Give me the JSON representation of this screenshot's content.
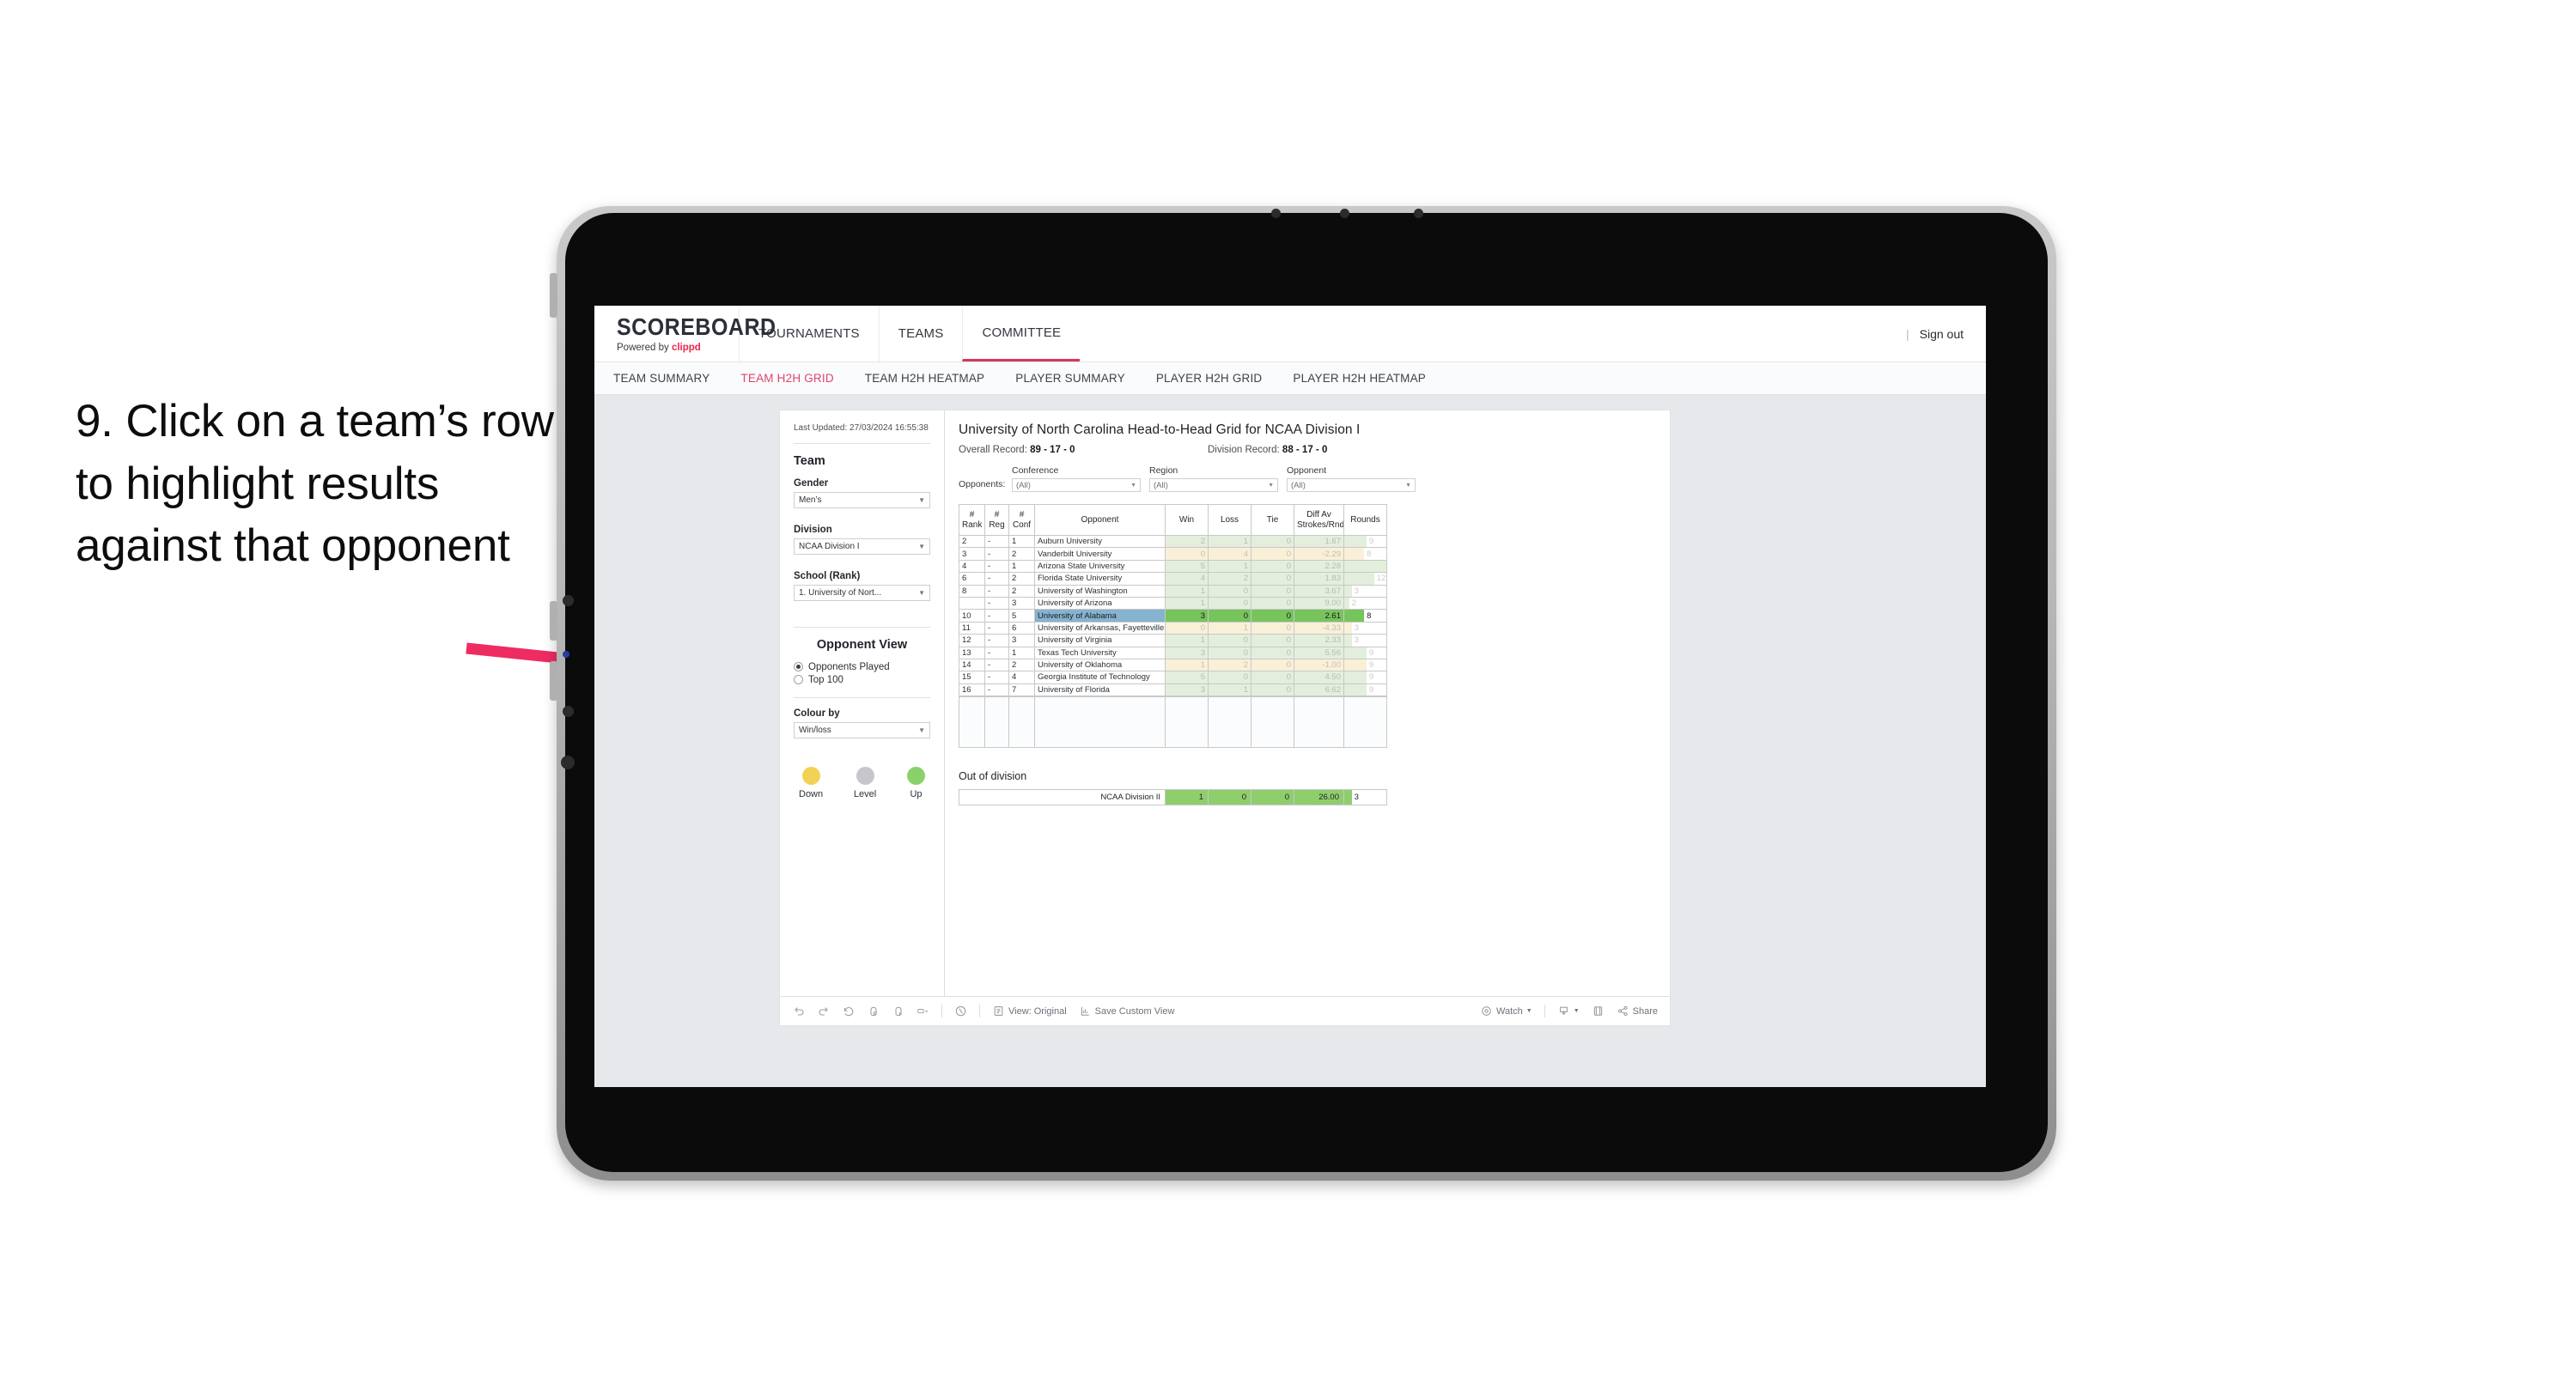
{
  "annotation": {
    "text": "9. Click on a team’s row to highlight results against that opponent",
    "arrow_color": "#ee2c62"
  },
  "topbar": {
    "brand_title": "SCOREBOARD",
    "brand_sub_prefix": "Powered by ",
    "brand_sub_name": "clippd",
    "nav": [
      {
        "label": "TOURNAMENTS",
        "active": false
      },
      {
        "label": "TEAMS",
        "active": false
      },
      {
        "label": "COMMITTEE",
        "active": true
      }
    ],
    "divider": "|",
    "sign_out": "Sign out"
  },
  "subnav": {
    "items": [
      {
        "label": "TEAM SUMMARY",
        "active": false
      },
      {
        "label": "TEAM H2H GRID",
        "active": true
      },
      {
        "label": "TEAM H2H HEATMAP",
        "active": false
      },
      {
        "label": "PLAYER SUMMARY",
        "active": false
      },
      {
        "label": "PLAYER H2H GRID",
        "active": false
      },
      {
        "label": "PLAYER H2H HEATMAP",
        "active": false
      }
    ],
    "accent": "#e0456b"
  },
  "panel": {
    "last_updated": "Last Updated: 27/03/2024 16:55:38",
    "team_heading": "Team",
    "gender_label": "Gender",
    "gender_value": "Men’s",
    "division_label": "Division",
    "division_value": "NCAA Division I",
    "school_label": "School (Rank)",
    "school_value": "1. University of Nort...",
    "opponent_view_heading": "Opponent View",
    "opponent_view_options": [
      {
        "label": "Opponents Played",
        "selected": true
      },
      {
        "label": "Top 100",
        "selected": false
      }
    ],
    "colour_by_label": "Colour by",
    "colour_by_value": "Win/loss",
    "legend": [
      {
        "label": "Down",
        "color": "#f2d255"
      },
      {
        "label": "Level",
        "color": "#c6c7ca"
      },
      {
        "label": "Up",
        "color": "#8ad16a"
      }
    ]
  },
  "main": {
    "title": "University of North Carolina Head-to-Head Grid for NCAA Division I",
    "overall_record_label": "Overall Record: ",
    "overall_record_value": "89 - 17 - 0",
    "division_record_label": "Division Record: ",
    "division_record_value": "88 - 17 - 0",
    "opponents_label": "Opponents:",
    "filters": [
      {
        "label": "Conference",
        "value": "(All)"
      },
      {
        "label": "Region",
        "value": "(All)"
      },
      {
        "label": "Opponent",
        "value": "(All)"
      }
    ],
    "out_of_division_title": "Out of division"
  },
  "chart_data": {
    "type": "table",
    "title": "University of North Carolina Head-to-Head Grid for NCAA Division I",
    "columns": [
      "# Rank",
      "# Reg",
      "# Conf",
      "Opponent",
      "Win",
      "Loss",
      "Tie",
      "Diff Av Strokes/Rnd",
      "Rounds"
    ],
    "rounds_max": 17,
    "rows": [
      {
        "rank": "2",
        "reg": "-",
        "conf": "1",
        "opponent": "Auburn University",
        "win": "2",
        "loss": "1",
        "tie": "0",
        "diff": "1.67",
        "rounds": "9",
        "tone": "up",
        "selected": false
      },
      {
        "rank": "3",
        "reg": "-",
        "conf": "2",
        "opponent": "Vanderbilt University",
        "win": "0",
        "loss": "4",
        "tie": "0",
        "diff": "-2.29",
        "rounds": "8",
        "tone": "down",
        "selected": false
      },
      {
        "rank": "4",
        "reg": "-",
        "conf": "1",
        "opponent": "Arizona State University",
        "win": "5",
        "loss": "1",
        "tie": "0",
        "diff": "2.28",
        "rounds": "17",
        "tone": "up",
        "selected": false
      },
      {
        "rank": "6",
        "reg": "-",
        "conf": "2",
        "opponent": "Florida State University",
        "win": "4",
        "loss": "2",
        "tie": "0",
        "diff": "1.83",
        "rounds": "12",
        "tone": "up",
        "selected": false
      },
      {
        "rank": "8",
        "reg": "-",
        "conf": "2",
        "opponent": "University of Washington",
        "win": "1",
        "loss": "0",
        "tie": "0",
        "diff": "3.67",
        "rounds": "3",
        "tone": "up",
        "selected": false
      },
      {
        "rank": "",
        "reg": "-",
        "conf": "3",
        "opponent": "University of Arizona",
        "win": "1",
        "loss": "0",
        "tie": "0",
        "diff": "9.00",
        "rounds": "2",
        "tone": "up",
        "selected": false
      },
      {
        "rank": "10",
        "reg": "-",
        "conf": "5",
        "opponent": "University of Alabama",
        "win": "3",
        "loss": "0",
        "tie": "0",
        "diff": "2.61",
        "rounds": "8",
        "tone": "up",
        "selected": true
      },
      {
        "rank": "11",
        "reg": "-",
        "conf": "6",
        "opponent": "University of Arkansas, Fayetteville",
        "win": "0",
        "loss": "1",
        "tie": "0",
        "diff": "-4.33",
        "rounds": "3",
        "tone": "down",
        "selected": false
      },
      {
        "rank": "12",
        "reg": "-",
        "conf": "3",
        "opponent": "University of Virginia",
        "win": "1",
        "loss": "0",
        "tie": "0",
        "diff": "2.33",
        "rounds": "3",
        "tone": "up",
        "selected": false
      },
      {
        "rank": "13",
        "reg": "-",
        "conf": "1",
        "opponent": "Texas Tech University",
        "win": "3",
        "loss": "0",
        "tie": "0",
        "diff": "5.56",
        "rounds": "9",
        "tone": "up",
        "selected": false
      },
      {
        "rank": "14",
        "reg": "-",
        "conf": "2",
        "opponent": "University of Oklahoma",
        "win": "1",
        "loss": "2",
        "tie": "0",
        "diff": "-1.00",
        "rounds": "9",
        "tone": "down",
        "selected": false
      },
      {
        "rank": "15",
        "reg": "-",
        "conf": "4",
        "opponent": "Georgia Institute of Technology",
        "win": "5",
        "loss": "0",
        "tie": "0",
        "diff": "4.50",
        "rounds": "9",
        "tone": "up",
        "selected": false
      },
      {
        "rank": "16",
        "reg": "-",
        "conf": "7",
        "opponent": "University of Florida",
        "win": "3",
        "loss": "1",
        "tie": "0",
        "diff": "6.62",
        "rounds": "9",
        "tone": "up",
        "selected": false
      }
    ],
    "out_of_division": [
      {
        "name": "NCAA Division II",
        "win": "1",
        "loss": "0",
        "tie": "0",
        "diff": "26.00",
        "rounds": "3"
      }
    ],
    "colors": {
      "up": "#e3efdc",
      "down": "#faf0d8",
      "selected_bar": "#77c35c",
      "selected_name": "#86b3cf"
    }
  },
  "toolbar": {
    "view_label": "View: Original",
    "save_label": "Save Custom View",
    "watch_label": "Watch",
    "share_label": "Share"
  }
}
